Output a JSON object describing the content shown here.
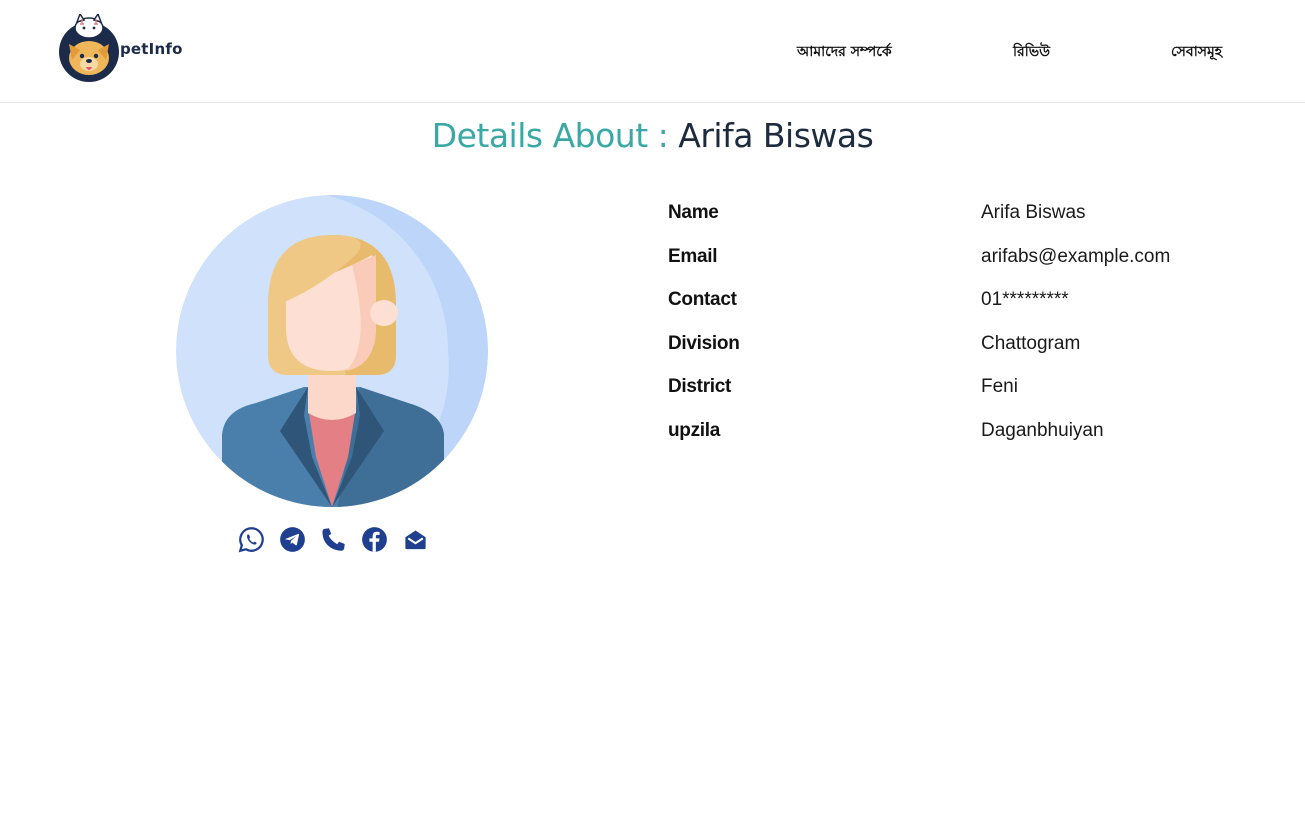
{
  "header": {
    "logo_text": "petInfo",
    "nav": [
      {
        "label": "আমাদের সম্পর্কে"
      },
      {
        "label": "রিভিউ"
      },
      {
        "label": "সেবাসমূহ"
      }
    ]
  },
  "title": {
    "prefix": "Details About :",
    "name": "Arifa Biswas"
  },
  "details": [
    {
      "label": "Name",
      "value": "Arifa Biswas"
    },
    {
      "label": "Email",
      "value": "arifabs@example.com"
    },
    {
      "label": "Contact",
      "value": "01*********"
    },
    {
      "label": "Division",
      "value": "Chattogram"
    },
    {
      "label": "District",
      "value": "Feni"
    },
    {
      "label": "upzila",
      "value": "Daganbhuiyan"
    }
  ],
  "socials": [
    {
      "icon": "whatsapp-icon"
    },
    {
      "icon": "telegram-icon"
    },
    {
      "icon": "phone-icon"
    },
    {
      "icon": "facebook-icon"
    },
    {
      "icon": "email-icon"
    }
  ],
  "colors": {
    "accent": "#3aa9a6",
    "title_dark": "#1d2b3e",
    "icon_blue": "#1f3f8f",
    "avatar_bg": "#cfe1fb"
  }
}
